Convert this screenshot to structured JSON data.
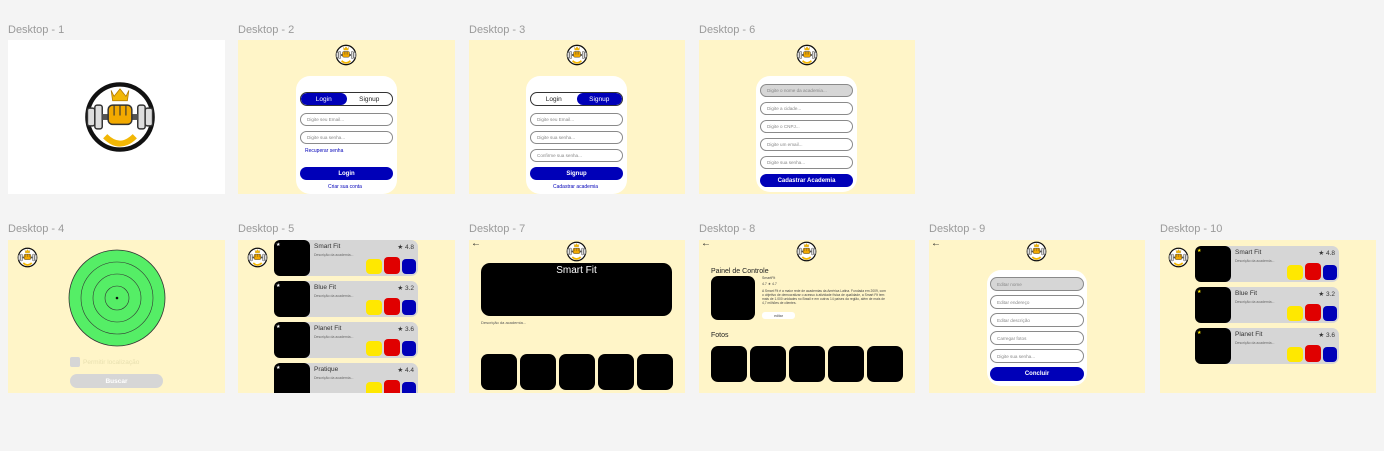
{
  "frames": {
    "d1": {
      "label": "Desktop - 1"
    },
    "d2": {
      "label": "Desktop - 2",
      "tab_login": "Login",
      "tab_signup": "Signup",
      "email_placeholder": "Digite seu Email...",
      "password_placeholder": "Digite sua senha...",
      "recover": "Recuperar senha",
      "button": "Login",
      "create": "Criar sua conta"
    },
    "d3": {
      "label": "Desktop - 3",
      "tab_login": "Login",
      "tab_signup": "Signup",
      "email_placeholder": "Digite seu Email...",
      "password_placeholder": "Digite sua senha...",
      "confirm_placeholder": "Confirme sua senha...",
      "button": "Signup",
      "register": "Cadastrar academia"
    },
    "d6": {
      "label": "Desktop - 6",
      "fields": [
        "Digite o nome da academia...",
        "Digite a cidade...",
        "Digite o CNPJ...",
        "Digite um email...",
        "Digite sua senha..."
      ],
      "button": "Cadastrar Academia"
    },
    "d4": {
      "label": "Desktop - 4",
      "checkbox_label": "Permitir localização",
      "button": "Buscar"
    },
    "d5": {
      "label": "Desktop - 5",
      "gyms": [
        {
          "name": "Smart Fit",
          "rating": "★ 4.8",
          "desc": "Descrição da academia..."
        },
        {
          "name": "Blue Fit",
          "rating": "★ 3.2",
          "desc": "Descrição da academia..."
        },
        {
          "name": "Planet Fit",
          "rating": "★ 3.6",
          "desc": "Descrição da academia..."
        },
        {
          "name": "Pratique",
          "rating": "★ 4.4",
          "desc": "Descrição da academia..."
        }
      ]
    },
    "d7": {
      "label": "Desktop - 7",
      "title": "Smart Fit",
      "desc": "Descrição da academia..."
    },
    "d8": {
      "label": "Desktop - 8",
      "heading": "Painel de Controle",
      "gym_name": "SmartFit",
      "rating": "4.7 ★ 4.7",
      "text": "A Smart Fit é a maior rede de academias da América Latina. Fundada em 2009, com o objetivo de democratizar o acesso à atividade física de qualidade, a Smart Fit tem mais de 1.000 unidades no Brasil e em outros 14 países da região, além de mais de 4,7 milhões de clientes.",
      "button": "editar",
      "photos": "Fotos"
    },
    "d9": {
      "label": "Desktop - 9",
      "fields": [
        "Editar nome",
        "Editar endereço",
        "Editar descrição",
        "Carregar fotos",
        "Digite sua senha..."
      ],
      "button": "Concluir"
    },
    "d10": {
      "label": "Desktop - 10",
      "gyms": [
        {
          "name": "Smart Fit",
          "rating": "★ 4.8",
          "desc": "Descrição da academia..."
        },
        {
          "name": "Blue Fit",
          "rating": "★ 3.2",
          "desc": "Descrição da academia..."
        },
        {
          "name": "Planet Fit",
          "rating": "★ 3.6",
          "desc": "Descrição da academia..."
        }
      ]
    }
  },
  "colors": {
    "cream": "#fff5c8",
    "blue": "#0000b8",
    "yellow": "#ffe800",
    "red": "#e00000",
    "radar": "#55ee66"
  },
  "icons": [
    "logo-icon",
    "back-arrow-icon",
    "star-icon"
  ]
}
